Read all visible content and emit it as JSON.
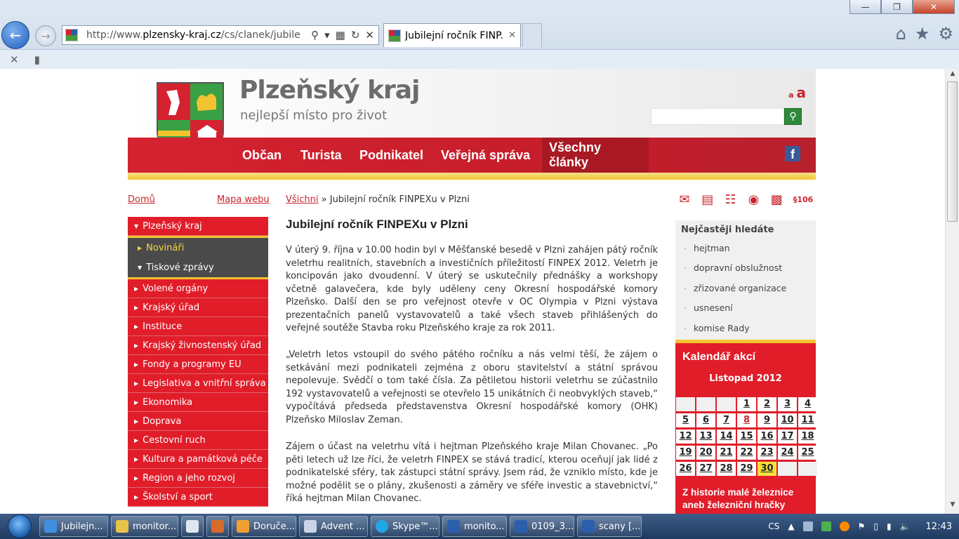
{
  "browser": {
    "window_controls": {
      "minimize": "—",
      "maximize": "❐",
      "close": "✕"
    },
    "url_prefix": "http://www.",
    "url_domain": "plzensky-kraj.cz",
    "url_path": "/cs/clanek/jubile",
    "tab_title": "Jubilejní ročník FINP...",
    "tab_close": "✕"
  },
  "site": {
    "title": "Plzeňský kraj",
    "slogan": "nejlepší místo pro život",
    "font_small": "a",
    "font_large": "a",
    "search_placeholder": "",
    "menu": [
      "Občan",
      "Turista",
      "Podnikatel",
      "Veřejná správa",
      "Všechny články"
    ],
    "facebook": "f"
  },
  "left": {
    "home": "Domů",
    "sitemap": "Mapa webu",
    "top_item": "Plzeňský kraj",
    "sub_items": [
      "Novináři",
      "Tiskové zprávy"
    ],
    "items": [
      "Volené orgány",
      "Krajský úřad",
      "Instituce",
      "Krajský živnostenský úřad",
      "Fondy a programy EU",
      "Legislativa a vnitřní správa",
      "Ekonomika",
      "Doprava",
      "Cestovní ruch",
      "Kultura a památková péče",
      "Region a jeho rozvoj",
      "Školství a sport"
    ]
  },
  "article": {
    "crumb_link": "Všichni",
    "crumb_rest": " » Jubilejní ročník FINPEXu v Plzni",
    "title": "Jubilejní ročník FINPEXu v Plzni",
    "p1": "V úterý 9. října v 10.00 hodin byl v Měšťanské besedě v Plzni zahájen pátý ročník veletrhu realitních, stavebních a investičních příležitostí FINPEX 2012. Veletrh je koncipován jako dvoudenní. V úterý se uskutečnily přednášky a workshopy včetně galavečera, kde byly uděleny ceny Okresní hospodářské komory Plzeňsko. Další den se pro veřejnost otevře v OC Olympia v Plzni výstava prezentačních panelů vystavovatelů a také všech staveb přihlášených do veřejné soutěže Stavba roku Plzeňského kraje za rok 2011.",
    "p2": "„Veletrh letos vstoupil do svého pátého ročníku a nás velmi těší, že zájem o setkávání mezi podnikateli zejména z oboru stavitelství a státní správou nepolevuje. Svědčí o tom také čísla. Za pětiletou historii veletrhu se zúčastnilo 192 vystavovatelů a veřejnosti se otevřelo 15 unikátních či neobvyklých staveb,“ vypočítává předseda představenstva Okresní hospodářské komory (OHK) Plzeňsko Miloslav Zeman.",
    "p3": "Zájem o účast na veletrhu vítá i hejtman Plzeňského kraje Milan Chovanec. „Po pěti letech už lze říci, že veletrh FINPEX se stává tradicí, kterou oceňují jak lidé z podnikatelské sféry, tak zástupci státní správy. Jsem rád, že vzniklo místo, kde je možné podělit se o plány, zkušenosti a záměry ve sféře investic a stavebnictví,“ říká hejtman Milan Chovanec."
  },
  "right": {
    "icon_badge": "§106",
    "popular_title": "Nejčastěji hledáte",
    "popular": [
      "hejtman",
      "dopravní obslužnost",
      "zřizované organizace",
      "usnesení",
      "komise Rady"
    ],
    "calendar_title": "Kalendář akcí",
    "calendar_month": "Listopad 2012",
    "calendar_days": [
      "",
      "",
      "",
      "1",
      "2",
      "3",
      "4",
      "5",
      "6",
      "7",
      "8",
      "9",
      "10",
      "11",
      "12",
      "13",
      "14",
      "15",
      "16",
      "17",
      "18",
      "19",
      "20",
      "21",
      "22",
      "23",
      "24",
      "25",
      "26",
      "27",
      "28",
      "29",
      "30",
      "",
      ""
    ],
    "calendar_note": "Z historie malé železnice aneb železniční hračky"
  },
  "taskbar": {
    "buttons": [
      "Jubilejn...",
      "monitor...",
      "",
      "",
      "Doruče...",
      "Advent ...",
      "Skype™...",
      "monito...",
      "0109_3...",
      "scany [..."
    ],
    "lang": "CS",
    "clock": "12:43"
  }
}
